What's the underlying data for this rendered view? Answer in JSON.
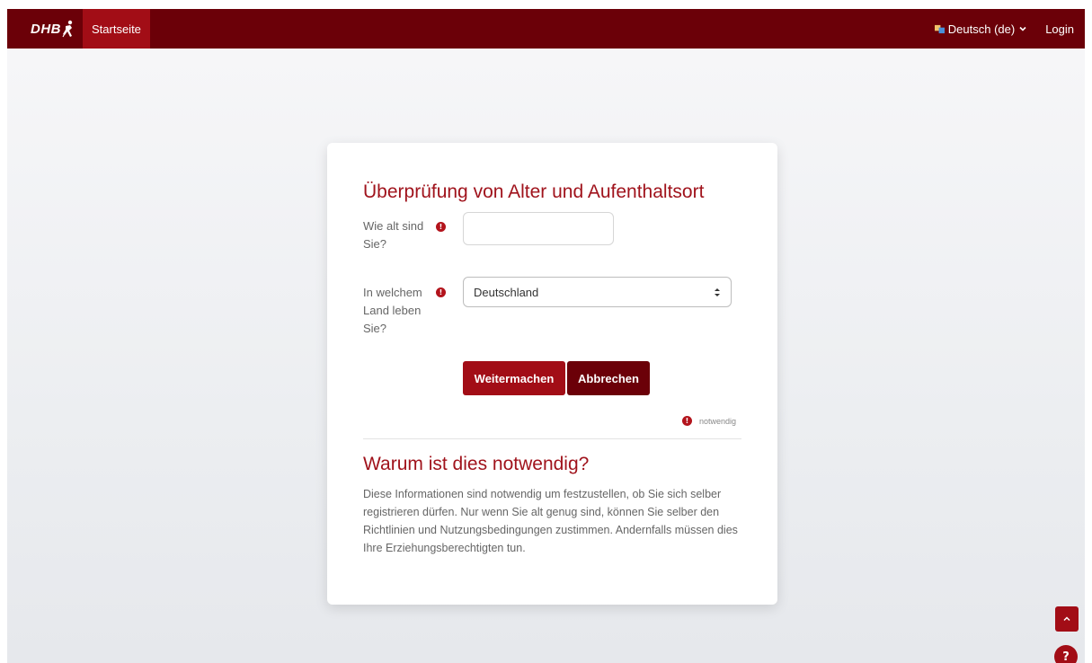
{
  "navbar": {
    "logo_text": "DHB",
    "home_label": "Startseite",
    "language_label": "Deutsch (de)",
    "login_label": "Login"
  },
  "form": {
    "title": "Überprüfung von Alter und Aufenthaltsort",
    "age_label": "Wie alt sind Sie?",
    "age_value": "",
    "country_label": "In welchem Land leben Sie?",
    "country_selected": "Deutschland",
    "continue_label": "Weitermachen",
    "cancel_label": "Abbrechen",
    "required_note": "notwendig",
    "required_icon": "!"
  },
  "info": {
    "title": "Warum ist dies notwendig?",
    "text": "Diese Informationen sind notwendig um festzustellen, ob Sie sich selber registrieren dürfen. Nur wenn Sie alt genug sind, können Sie selber den Richtlinien und Nutzungsbedingungen zustimmen. Andernfalls müssen dies Ihre Erziehungsberechtigten tun."
  },
  "floating": {
    "help_label": "?"
  },
  "colors": {
    "navbar": "#6b0008",
    "accent": "#a20d16",
    "heading": "#a0131c"
  }
}
